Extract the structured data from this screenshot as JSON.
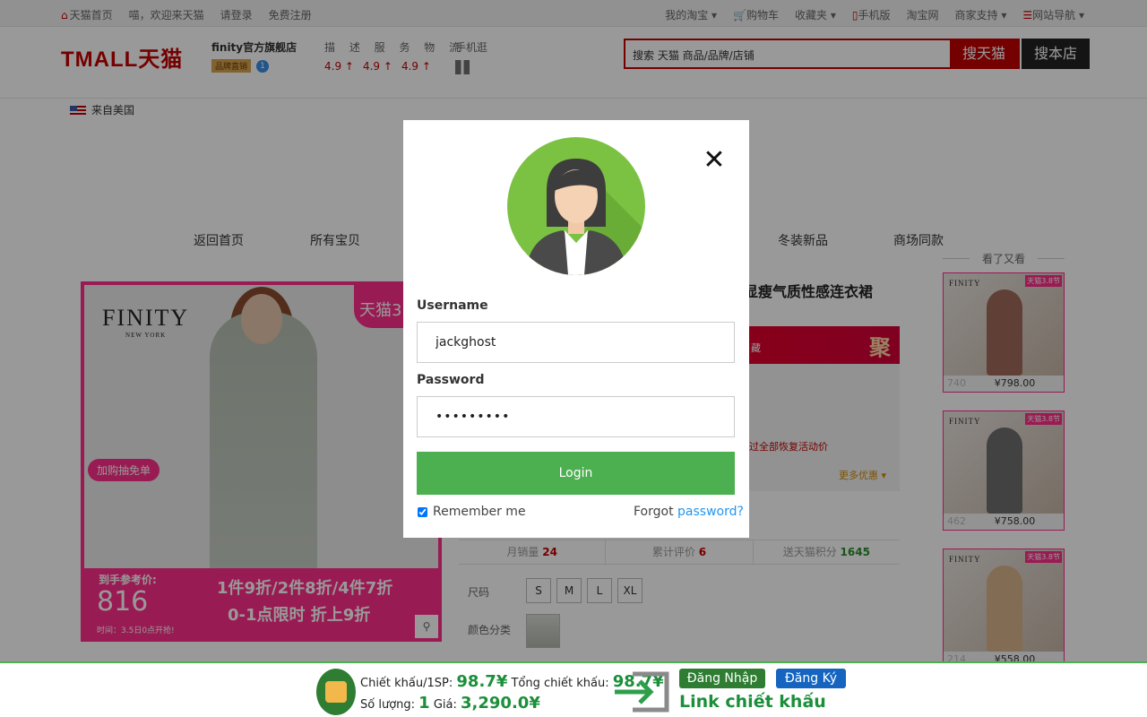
{
  "topbar": {
    "left": [
      "天猫首页",
      "喵，欢迎来天猫",
      "请登录",
      "免费注册"
    ],
    "right": [
      "我的淘宝",
      "购物车",
      "收藏夹",
      "手机版",
      "淘宝网",
      "商家支持",
      "网站导航"
    ]
  },
  "header": {
    "logo": "TMALL天猫",
    "shop_name": "finity官方旗舰店",
    "shop_badge": "品牌直销",
    "shop_dot": "1",
    "score_labels": "描 述 服 务 物 流",
    "scores": [
      "4.9",
      "4.9",
      "4.9"
    ],
    "mobile": "手机逛",
    "search_placeholder": "搜索 天猫 商品/品牌/店铺",
    "search_button": "搜天猫",
    "store_button": "搜本店"
  },
  "origin": "来自美国",
  "nav": [
    "返回首页",
    "所有宝贝",
    "冬装新品",
    "商场同款"
  ],
  "product": {
    "brand": "FINITY",
    "brand_sub": "NEW YORK",
    "tag_top": "天猫3",
    "tag_side": "加购抽免单",
    "price_label": "到手参考价:",
    "price": "816",
    "time_text": "时间：3.5日0点开抢!",
    "promo1": "1件9折/2件8折/4件7折",
    "promo2": "0-1点限时 折上9折",
    "title_fragment": "腰显瘦气质性感连衣裙",
    "promo_bar_text": "藏",
    "promo_ju": "聚",
    "restore_text": "过全部恢复活动价",
    "more_discount": "更多优惠"
  },
  "stats": {
    "sales_label": "月销量",
    "sales": "24",
    "reviews_label": "累计评价",
    "reviews": "6",
    "points_label": "送天猫积分",
    "points": "1645"
  },
  "options": {
    "size_label": "尺码",
    "sizes": [
      "S",
      "M",
      "L",
      "XL"
    ],
    "color_label": "颜色分类"
  },
  "side": {
    "heading": "看了又看",
    "items": [
      {
        "price": "¥798.00",
        "brand": "FINITY",
        "tag": "天猫3.8节",
        "faded": "740"
      },
      {
        "price": "¥758.00",
        "brand": "FINITY",
        "tag": "天猫3.8节",
        "faded": "462"
      },
      {
        "price": "¥558.00",
        "brand": "FINITY",
        "tag": "天猫3.8节",
        "faded": "214"
      }
    ]
  },
  "modal": {
    "username_label": "Username",
    "username_value": "jackghost",
    "password_label": "Password",
    "password_value": "•••••••••",
    "login_label": "Login",
    "remember_label": "Remember me",
    "forgot_prefix": "Forgot ",
    "forgot_link": "password?",
    "close_glyph": "✕"
  },
  "bottombar": {
    "discount_label": "Chiết khấu/1SP:",
    "discount_value": "98.7¥",
    "total_label": "Tổng chiết khấu:",
    "total_value": "98.7¥",
    "qty_label": "Số lượng:",
    "qty_value": "1",
    "price_label": "Giá:",
    "price_value": "3,290.0¥",
    "login_button": "Đăng Nhập",
    "register_button": "Đăng Ký",
    "link_text": "Link chiết khấu"
  },
  "colors": {
    "tmall_red": "#c40000",
    "pink": "#ff2d8a",
    "login_green": "#4caf50",
    "link_blue": "#2196f3",
    "register_blue": "#1565c0"
  }
}
